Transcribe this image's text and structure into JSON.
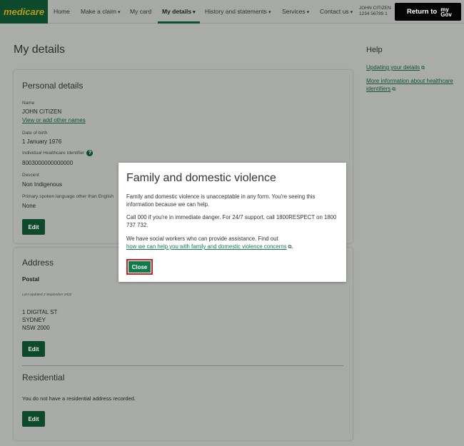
{
  "nav": {
    "logo": "medicare",
    "items": [
      {
        "label": "Home",
        "caret": false
      },
      {
        "label": "Make a claim",
        "caret": true
      },
      {
        "label": "My card",
        "caret": false
      },
      {
        "label": "My details",
        "caret": true
      },
      {
        "label": "History and statements",
        "caret": true
      },
      {
        "label": "Services",
        "caret": true
      },
      {
        "label": "Contact us",
        "caret": true
      }
    ],
    "user_name": "JOHN CITIZEN",
    "user_number": "1234 56789 1",
    "return_label": "Return to",
    "mygov_line1": "my",
    "mygov_line2": "Gov"
  },
  "page": {
    "title": "My details"
  },
  "help": {
    "title": "Help",
    "links": [
      "Updating your details",
      "More information about healthcare identifiers"
    ]
  },
  "personal": {
    "title": "Personal details",
    "name_label": "Name",
    "name_value": "JOHN CITIZEN",
    "other_names_link": "View or add other names",
    "dob_label": "Date of birth",
    "dob_value": "1 January 1976",
    "ihi_label": "Individual Healthcare Identifier",
    "ihi_value": "8003000000000000",
    "descent_label": "Descent",
    "descent_value": "Non Indigenous",
    "language_label": "Primary spoken language other than English",
    "language_value": "None",
    "edit_label": "Edit"
  },
  "address": {
    "title": "Address",
    "postal_heading": "Postal",
    "last_updated": "Last Updated 2 September 2022",
    "line1": "1 DIGITAL ST",
    "line2": "SYDNEY",
    "line3": "NSW 2000",
    "edit_label": "Edit",
    "residential_title": "Residential",
    "residential_text": "You do not have a residential address recorded.",
    "residential_edit_label": "Edit"
  },
  "modal": {
    "title": "Family and domestic violence",
    "p1": "Family and domestic violence is unacceptable in any form. You're seeing this information because we can help.",
    "p2": "Call 000 if you're in immediate danger. For 24/7 support, call 1800RESPECT on 1800 737 732.",
    "p3": "We have social workers who can provide assistance. Find out",
    "p3_link": "how we can help you with family and domestic violence concerns",
    "p3_end": ".",
    "close_label": "Close"
  },
  "colors": {
    "brand_green": "#0d4a2c",
    "accent_gold": "#b99a14",
    "link_green": "#117a4d",
    "focus_red": "#c81f25"
  }
}
